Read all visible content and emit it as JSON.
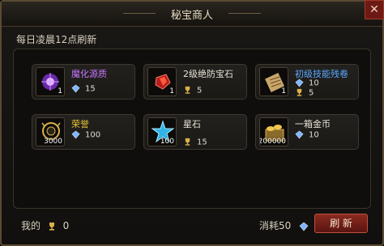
{
  "window": {
    "title": "秘宝商人",
    "close_glyph": "✕"
  },
  "refresh_note": "每日凌晨12点刷新",
  "items": [
    {
      "name": "魔化源质",
      "name_color": "#c777ff",
      "qty": "1",
      "price_currency": "diamond-icon",
      "price": "15",
      "limit_icon": "",
      "limit": "",
      "icon": "purple-orb-icon"
    },
    {
      "name": "2级绝防宝石",
      "name_color": "#e8e4d8",
      "qty": "1",
      "price_currency": "trophy-icon",
      "price": "5",
      "limit_icon": "",
      "limit": "",
      "icon": "red-gem-icon"
    },
    {
      "name": "初级技能残卷",
      "name_color": "#5aa8ff",
      "qty": "1",
      "price_currency": "diamond-icon",
      "price": "10",
      "limit_icon": "trophy-icon",
      "limit": "5",
      "icon": "scroll-icon"
    },
    {
      "name": "荣誉",
      "name_color": "#e8c43a",
      "qty": "3000",
      "price_currency": "diamond-icon",
      "price": "100",
      "limit_icon": "",
      "limit": "",
      "icon": "honor-medal-icon"
    },
    {
      "name": "星石",
      "name_color": "#e8e4d8",
      "qty": "100",
      "price_currency": "trophy-icon",
      "price": "15",
      "limit_icon": "",
      "limit": "",
      "icon": "star-stone-icon"
    },
    {
      "name": "一箱金币",
      "name_color": "#e8e4d8",
      "qty": "200000",
      "price_currency": "diamond-icon",
      "price": "10",
      "limit_icon": "",
      "limit": "",
      "icon": "gold-coins-icon"
    }
  ],
  "footer": {
    "mine_label": "我的",
    "mine_value": "0",
    "cost_label": "消耗50",
    "refresh_label": "刷  新"
  }
}
